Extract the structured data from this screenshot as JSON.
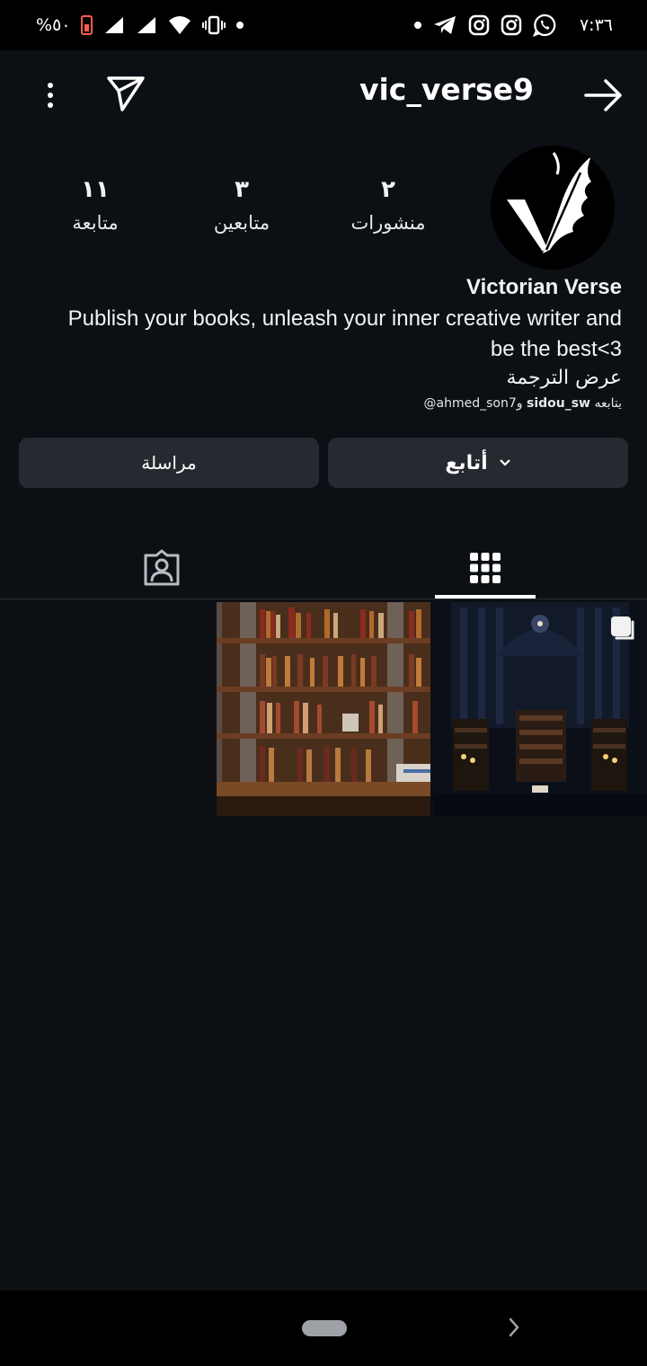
{
  "status_bar": {
    "time": "٧:٣٦",
    "battery": "%٥٠",
    "icons": [
      "whatsapp-icon",
      "instagram-icon",
      "instagram-icon",
      "telegram-icon",
      "notification-dot",
      "dot",
      "vibrate-icon",
      "wifi-icon",
      "signal-icon",
      "signal-icon",
      "battery-icon"
    ]
  },
  "header": {
    "username": "vic_verse9"
  },
  "profile": {
    "stats": {
      "posts": {
        "count": "٢",
        "label": "منشورات"
      },
      "followers": {
        "count": "٣",
        "label": "متابعين"
      },
      "following": {
        "count": "١١",
        "label": "متابعة"
      }
    },
    "display_name": "Victorian Verse",
    "bio_line1": "Publish your books, unleash your inner creative writer and",
    "bio_line2": "be the best<3",
    "translate_label": "عرض الترجمة",
    "followed_by_prefix": "يتابعه",
    "followed_by_user1": "sidou_sw",
    "followed_by_and": "و",
    "followed_by_user2": "@ahmed_son7"
  },
  "actions": {
    "follow_label": "أتابع",
    "message_label": "مراسلة"
  },
  "tabs": [
    "grid-icon",
    "tagged-icon"
  ],
  "colors": {
    "background": "#0c0f14",
    "button": "#262930",
    "battery": "#ff5b4f"
  }
}
